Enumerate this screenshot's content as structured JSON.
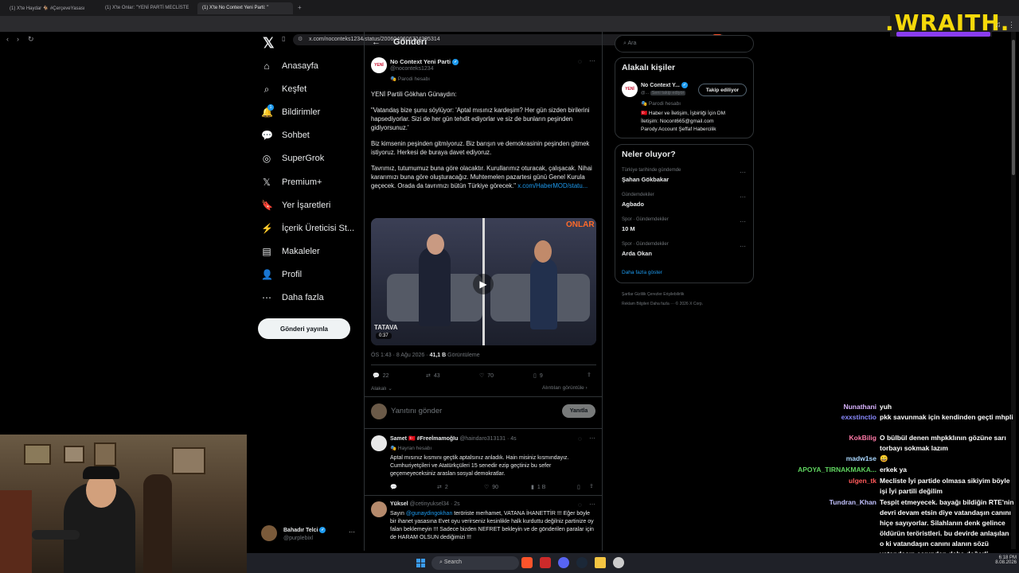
{
  "browser": {
    "tabs": [
      "(1) X'te Haydar 🐐 #ÇerçeveYasası",
      "(1) X'te Onlar: \"YENİ PARTİ MECLİSTE",
      "(1) X'te No Context Yeni Parti: \""
    ],
    "new_tab": "+",
    "url": "x.com/noconteks1234/status/2006040606724305314"
  },
  "stream_logo": ".WRAITH.",
  "nav": {
    "items": [
      {
        "label": "Anasayfa",
        "icon": "⌂",
        "name": "home"
      },
      {
        "label": "Keşfet",
        "icon": "⌕",
        "name": "explore"
      },
      {
        "label": "Bildirimler",
        "icon": "🔔",
        "name": "notifications",
        "badge": "1"
      },
      {
        "label": "Sohbet",
        "icon": "💬",
        "name": "chat"
      },
      {
        "label": "SuperGrok",
        "icon": "◎",
        "name": "supergrok"
      },
      {
        "label": "Premium+",
        "icon": "𝕏",
        "name": "premium"
      },
      {
        "label": "Yer İşaretleri",
        "icon": "🔖",
        "name": "bookmarks"
      },
      {
        "label": "İçerik Üreticisi St...",
        "icon": "⚡",
        "name": "creator-studio"
      },
      {
        "label": "Makaleler",
        "icon": "▤",
        "name": "articles"
      },
      {
        "label": "Profil",
        "icon": "👤",
        "name": "profile"
      },
      {
        "label": "Daha fazla",
        "icon": "⋯",
        "name": "more"
      }
    ],
    "post_button": "Gönderi yayınla",
    "account": {
      "name": "Bahadır Telci",
      "handle": "@purplebixl",
      "more": "···"
    }
  },
  "main": {
    "header_title": "Gönderi",
    "post": {
      "author": "No Context Yeni Parti",
      "handle": "@noconteks1234",
      "parody": "🎭 Parodi hesabı",
      "avatar_text": "YENİ",
      "paragraphs": [
        "YENİ Partili Gökhan Günaydın:",
        "\"Vatandaş bize şunu söylüyor: 'Aptal mısınız kardeşim? Her gün sizden birilerini hapsediyorlar. Sizi de her gün tehdit ediyorlar ve siz de bunların peşinden gidiyorsunuz.'",
        "Biz kimsenin peşinden gitmiyoruz. Biz barışın ve demokrasinin peşinden gitmek istiyoruz. Herkesi de buraya davet ediyoruz.",
        "Tavrımız, tutumumuz buna göre olacaktır. Kurullarımız oturacak, çalışacak. Nihai kararımızı buna göre oluşturacağız. Muhtemelen pazartesi günü Genel Kurula geçecek. Orada da tavrımızı bütün Türkiye görecek.\""
      ],
      "link": "x.com/HaberMOD/statu...",
      "video_logo": "ONLAR",
      "video_caption": "TATAVA",
      "video_time": "0:37",
      "meta_time": "ÖS 1:43 · 8 Ağu 2026 · ",
      "meta_views": "41,1 B",
      "meta_views_label": " Görüntüleme",
      "stats": {
        "replies": "22",
        "reposts": "43",
        "likes": "70",
        "bookmarks": "9"
      },
      "relevant": "Alakalı ⌄",
      "quotes_link": "Alıntıları görüntüle ›"
    },
    "reply_box": {
      "placeholder": "Yanıtını gönder",
      "button": "Yanıtla"
    },
    "replies": [
      {
        "author": "Samet 🇹🇷 #FreeİmamoğIu",
        "handle": "@haindaro313131 · 4s",
        "sub": "🎭 Hayran hesabı",
        "text": "Aptal mısınız kısmını geçtik aptalsınız anladık. Hain misiniz kısmındayız. Cumhuriyetçileri ve Atatürkçüleri 15 senedir ezip geçtiniz bu sefer geçemeyeceksiniz araslan sosyal demokratlar.",
        "stats": {
          "reposts": "2",
          "likes": "90",
          "views": "1 B"
        }
      },
      {
        "author": "Yüksel",
        "handle": "@cetinyuksel34 · 2s",
        "text_prefix": "Sayın ",
        "mention": "@gunaydingokhan",
        "text": " teröriste merhamet, VATANA İHANETTİR !!! Eğer böyle bir ihanet yasasına Evet oyu verirseniz kesinlikle halk kurduttu değilniz partinize oy falan beklemeyin !!! Sadece bizden NEFRET bekleyin ve de gönderilen paralar için de HARAM OLSUN dediğimizi !!!"
      }
    ]
  },
  "right": {
    "search_placeholder": "Ara",
    "related": {
      "title": "Alakalı kişiler",
      "name": "No Context Y...",
      "handle": "@...",
      "follows_you": "Seni takip ediyor",
      "follow_button": "Takip ediliyor",
      "parody": "🎭 Parodi hesabı",
      "bio_line1": "🇹🇷 Haber ve İletişim, İşbirliği İçin DM",
      "bio_line2": "İletişim: Nocont665@gmail.com",
      "bio_line3": "Parody Account Şeffaf Habercilik"
    },
    "trends": {
      "title": "Neler oluyor?",
      "items": [
        {
          "category": "Türkiye tarihinde gündemde",
          "name": "Şahan Gökbakar"
        },
        {
          "category": "Gündemdekiler",
          "name": "Agbado"
        },
        {
          "category": "Spor · Gündemdekiler",
          "name": "10 M"
        },
        {
          "category": "Spor · Gündemdekiler",
          "name": "Arda Okan"
        }
      ],
      "show_more": "Daha fazla göster"
    },
    "footer_line1": "Şartlar    Gizlilik    Çerezler    Erişilebilirlik",
    "footer_line2": "Reklam Bilgileri    Daha fazla ···    © 2026 X Corp."
  },
  "chat": [
    {
      "user": "Nunathani",
      "color": "#d9b3ff",
      "msg": "yuh"
    },
    {
      "user": "exxstinctio",
      "color": "#8a8aff",
      "msg": "pkk savunmak için kendinden geçti mhpli",
      "badge": true
    },
    {
      "user": "KokBilig",
      "color": "#ff7aa8",
      "msg": "O bülbül denen mhpkklının gözüne sarı torbayı sokmak lazım"
    },
    {
      "user": "madw1se",
      "color": "#a9d7ff",
      "msg": "😀"
    },
    {
      "user": "APOYA_TIRNAKMAKA...",
      "color": "#5fd35f",
      "msg": "erkek ya"
    },
    {
      "user": "ulgen_tk",
      "color": "#ff5a5a",
      "msg": "Mecliste İyi partide olmasa sikiyim böyle işi İyi partili değilim"
    },
    {
      "user": "Tundran_Khan",
      "color": "#c2c2ff",
      "msg": "Tespit etmeyecek. bayağı bildiğin RTE'nin devri devam etsin diye vatandaşın canını hiçe sayıyorlar. Silahlanın denk gelince öldürün teröristleri. bu devirde anlaşılan o ki vatandaşın canını alanın sözü vatandaşın canından daha değerli"
    }
  ],
  "taskbar": {
    "search_placeholder": "Search",
    "time": "6:18 PM",
    "date": "8.08.2026"
  },
  "colors": {
    "accent": "#1d9bf0",
    "background": "#000000",
    "border": "#2f3336",
    "logo": "#f5d90a"
  }
}
